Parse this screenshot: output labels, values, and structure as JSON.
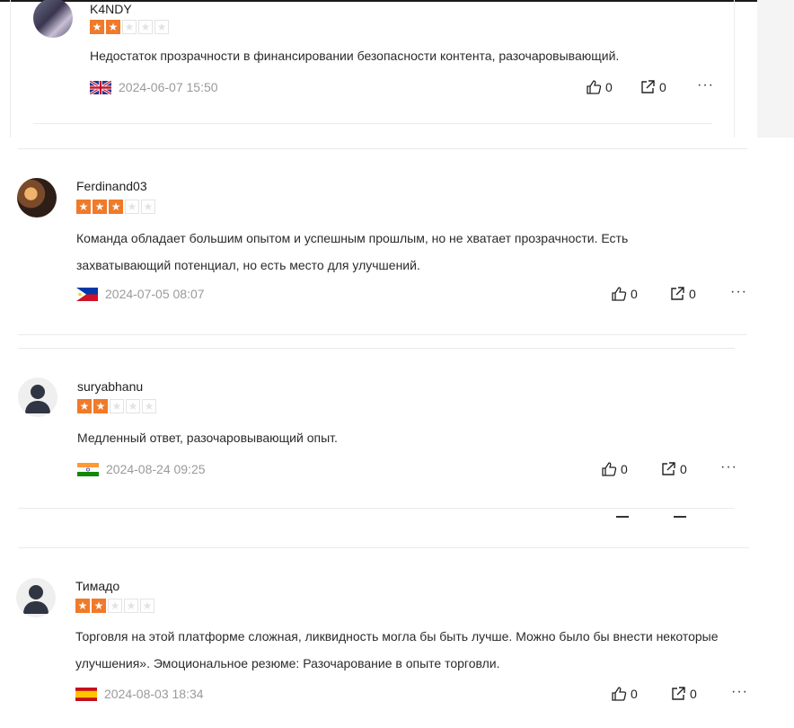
{
  "reviews": [
    {
      "username": "K4NDY",
      "rating": 2,
      "text": "Недостаток прозрачности в финансировании безопасности контента, разочаровывающий.",
      "country_flag": "united-kingdom",
      "date": "2024-06-07 15:50",
      "likes": "0",
      "shares": "0"
    },
    {
      "username": "Ferdinand03",
      "rating": 3,
      "text": "Команда обладает большим опытом и успешным прошлым, но не хватает прозрачности. Есть захватывающий потенциал, но есть место для улучшений.",
      "country_flag": "philippines",
      "date": "2024-07-05 08:07",
      "likes": "0",
      "shares": "0"
    },
    {
      "username": "suryabhanu",
      "rating": 2,
      "text": "Медленный ответ, разочаровывающий опыт.",
      "country_flag": "india",
      "date": "2024-08-24 09:25",
      "likes": "0",
      "shares": "0"
    },
    {
      "username": "Тимадо",
      "rating": 2,
      "text": "Торговля на этой платформе сложная, ликвидность могла бы быть лучше. Можно было бы внести некоторые улучшения». Эмоциональное резюме: Разочарование в опыте торговли.",
      "country_flag": "spain",
      "date": "2024-08-03 18:34",
      "likes": "0",
      "shares": "0"
    }
  ],
  "more_label": "···",
  "colors": {
    "star_on": "#f07a2a",
    "star_off_border": "#e3e3e3",
    "date": "#9a9a9a"
  }
}
